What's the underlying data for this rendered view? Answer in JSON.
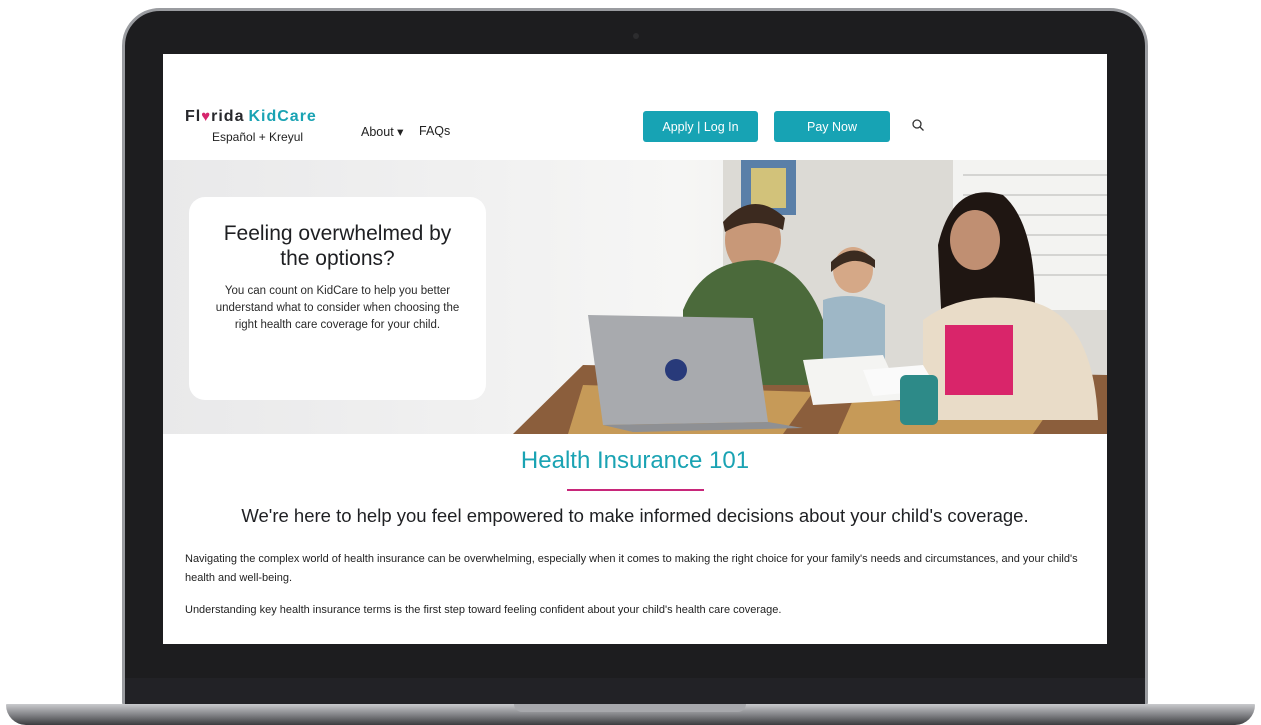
{
  "header": {
    "logo": {
      "florida": "Fl",
      "heart": "♥",
      "rida": "rida",
      "kidcare": "KidCare"
    },
    "language_link": "Español + Kreyul",
    "nav": {
      "about": "About ▾",
      "faqs": "FAQs"
    },
    "buttons": {
      "apply": "Apply | Log In",
      "pay": "Pay Now"
    },
    "search_icon": "search-icon"
  },
  "hero": {
    "title": "Feeling overwhelmed by the options?",
    "text": "You can count on KidCare to help you better understand what to consider when choosing the right health care coverage for your child."
  },
  "content": {
    "title": "Health Insurance 101",
    "tagline": "We're here to help you feel empowered to make informed decisions about your child's coverage.",
    "paragraph_1": "Navigating the complex world of health insurance can be overwhelming, especially when it comes to making the right choice for your family's needs and circumstances, and your child's health and well-being.",
    "paragraph_2": "Understanding key health insurance terms is the first step toward feeling confident about your child's health care coverage."
  },
  "colors": {
    "accent": "#17a3b4",
    "rule": "#c8277a",
    "heart": "#d6266d"
  }
}
